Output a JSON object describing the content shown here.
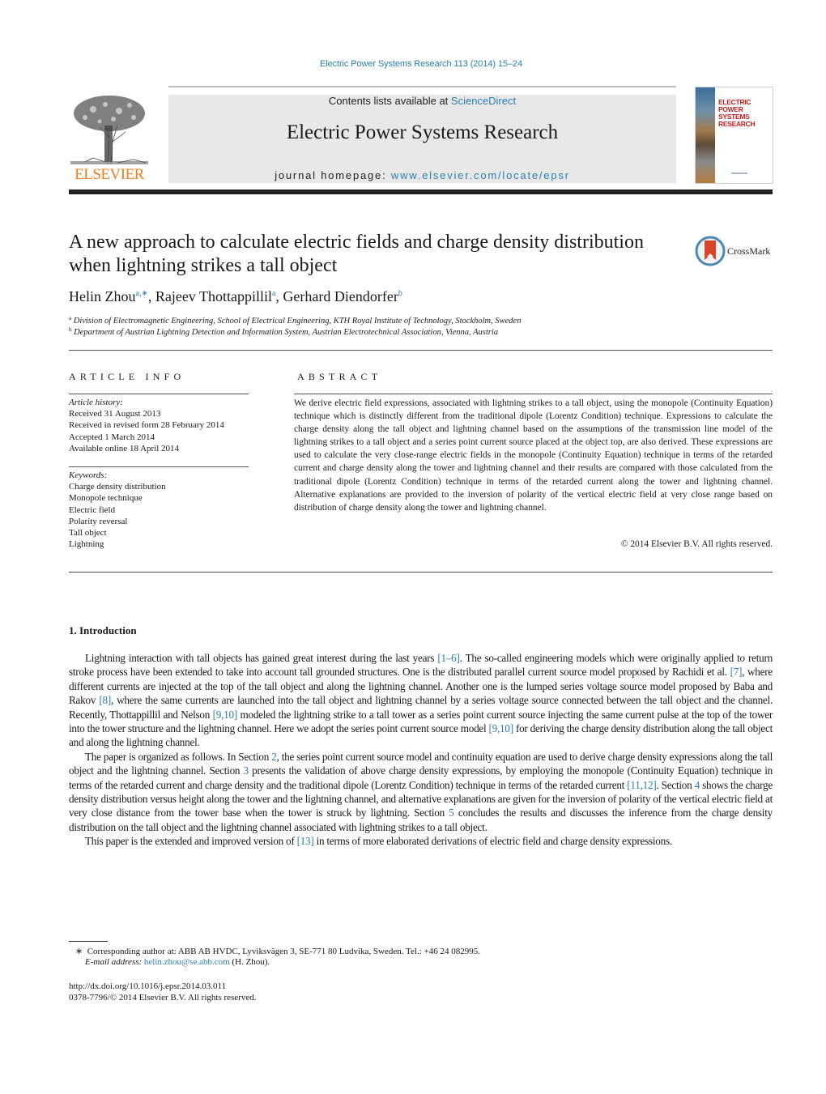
{
  "masthead": {
    "citation": "Electric Power Systems Research 113 (2014) 15–24",
    "contents_prefix": "Contents lists available at ",
    "contents_link": "ScienceDirect",
    "journal_title": "Electric Power Systems Research",
    "homepage_prefix": "journal homepage: ",
    "homepage_link": "www.elsevier.com/locate/epsr",
    "publisher_logo_text": "ELSEVIER",
    "cover_title_line1": "ELECTRIC POWER",
    "cover_title_line2": "SYSTEMS RESEARCH"
  },
  "article": {
    "title": "A new approach to calculate electric fields and charge density distribution when lightning strikes a tall object",
    "crossmark_label": "CrossMark",
    "authors": [
      {
        "name": "Helin Zhou",
        "sup": "a,∗"
      },
      {
        "name": "Rajeev Thottappillil",
        "sup": "a"
      },
      {
        "name": "Gerhard Diendorfer",
        "sup": "b"
      }
    ],
    "affiliations": [
      {
        "key": "a",
        "text": "Division of Electromagnetic Engineering, School of Electrical Engineering, KTH Royal Institute of Technology, Stockholm, Sweden"
      },
      {
        "key": "b",
        "text": "Department of Austrian Lightning Detection and Information System, Austrian Electrotechnical Association, Vienna, Austria"
      }
    ]
  },
  "article_info": {
    "heading": "ARTICLE INFO",
    "history_label": "Article history:",
    "history": [
      "Received 31 August 2013",
      "Received in revised form 28 February 2014",
      "Accepted 1 March 2014",
      "Available online 18 April 2014"
    ],
    "keywords_label": "Keywords:",
    "keywords": [
      "Charge density distribution",
      "Monopole technique",
      "Electric field",
      "Polarity reversal",
      "Tall object",
      "Lightning"
    ]
  },
  "abstract": {
    "heading": "ABSTRACT",
    "text": "We derive electric field expressions, associated with lightning strikes to a tall object, using the monopole (Continuity Equation) technique which is distinctly different from the traditional dipole (Lorentz Condition) technique. Expressions to calculate the charge density along the tall object and lightning channel based on the assumptions of the transmission line model of the lightning strikes to a tall object and a series point current source placed at the object top, are also derived. These expressions are used to calculate the very close-range electric fields in the monopole (Continuity Equation) technique in terms of the retarded current and charge density along the tower and lightning channel and their results are compared with those calculated from the traditional dipole (Lorentz Condition) technique in terms of the retarded current along the tower and lightning channel. Alternative explanations are provided to the inversion of polarity of the vertical electric field at very close range based on distribution of charge density along the tower and lightning channel.",
    "copyright": "© 2014 Elsevier B.V. All rights reserved."
  },
  "introduction": {
    "heading": "1.  Introduction",
    "paragraphs": [
      [
        {
          "t": "Lightning interaction with tall objects has gained great interest during the last years "
        },
        {
          "link": "[1–6]"
        },
        {
          "t": ". The so-called engineering models which were originally applied to return stroke process have been extended to take into account tall grounded structures. One is the distributed parallel current source model proposed by Rachidi et al. "
        },
        {
          "link": "[7]"
        },
        {
          "t": ", where different currents are injected at the top of the tall object and along the lightning channel. Another one is the lumped series voltage source model proposed by Baba and Rakov "
        },
        {
          "link": "[8]"
        },
        {
          "t": ", where the same currents are launched into the tall object and lightning channel by a series voltage source connected between the tall object and the channel. Recently, Thottappillil and Nelson "
        },
        {
          "link": "[9,10]"
        },
        {
          "t": " modeled the lightning strike to a tall tower as a series point current source injecting the same current pulse at the top of the tower into the tower structure and the lightning channel. Here we adopt the series point current source model "
        },
        {
          "link": "[9,10]"
        },
        {
          "t": " for deriving the charge density distribution along the tall object and along the lightning channel."
        }
      ],
      [
        {
          "t": "The paper is organized as follows. In Section "
        },
        {
          "link": "2"
        },
        {
          "t": ", the series point current source model and continuity equation are used to derive charge density expressions along the tall object and the lightning channel. Section "
        },
        {
          "link": "3"
        },
        {
          "t": " presents the validation of above charge density expressions, by employing the monopole (Continuity Equation) technique in terms of the retarded current and charge density and the traditional dipole (Lorentz Condition) technique in terms of the retarded current "
        },
        {
          "link": "[11,12]"
        },
        {
          "t": ". Section "
        },
        {
          "link": "4"
        },
        {
          "t": " shows the charge density distribution versus height along the tower and the lightning channel, and alternative explanations are given for the inversion of polarity of the vertical electric field at very close distance from the tower base when the tower is struck by lightning. Section "
        },
        {
          "link": "5"
        },
        {
          "t": " concludes the results and discusses the inference from the charge density distribution on the tall object and the lightning channel associated with lightning strikes to a tall object."
        }
      ],
      [
        {
          "t": "This paper is the extended and improved version of "
        },
        {
          "link": "[13]"
        },
        {
          "t": " in terms of more elaborated derivations of electric field and charge density expressions."
        }
      ]
    ]
  },
  "footnotes": {
    "star_marker": "∗",
    "corresponding": "Corresponding author at: ABB AB HVDC, Lyviksvägen 3, SE-771 80 Ludvika, Sweden. Tel.: +46 24 082995.",
    "email_label": "E-mail address: ",
    "email": "helin.zhou@se.abb.com",
    "email_suffix": " (H. Zhou).",
    "doi": "http://dx.doi.org/10.1016/j.epsr.2014.03.011",
    "issn": "0378-7796/© 2014 Elsevier B.V. All rights reserved."
  },
  "colors": {
    "link": "#2a7fb0",
    "elsevier_orange": "#f07c1b",
    "masthead_gray": "#e8e8e8",
    "crossmark_red": "#d9452b"
  }
}
